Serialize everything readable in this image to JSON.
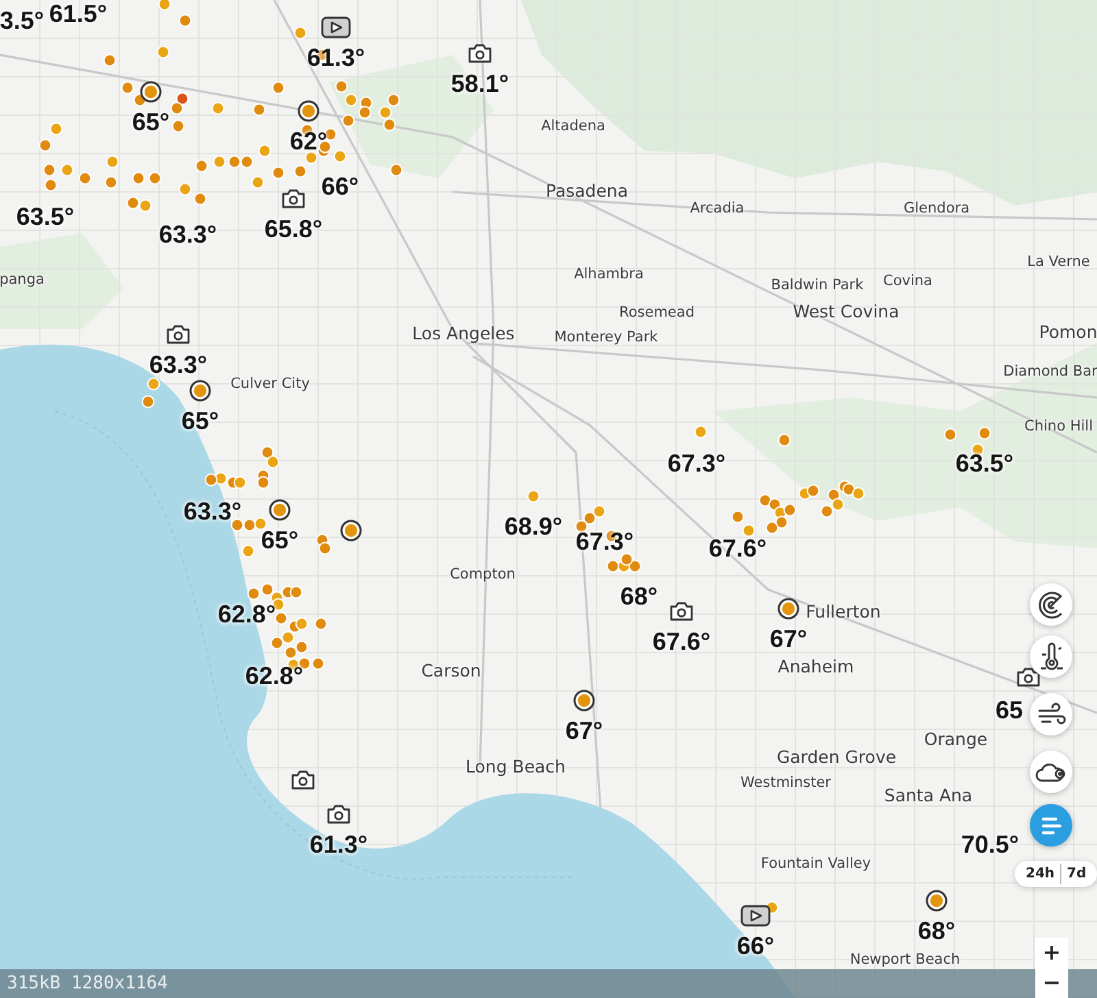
{
  "map": {
    "places": [
      {
        "name": "panga",
        "kind": "town"
      },
      {
        "name": "Altadena",
        "kind": "town"
      },
      {
        "name": "Pasadena",
        "kind": "city"
      },
      {
        "name": "Arcadia",
        "kind": "town"
      },
      {
        "name": "Glendora",
        "kind": "town"
      },
      {
        "name": "La Verne",
        "kind": "town"
      },
      {
        "name": "Alhambra",
        "kind": "town"
      },
      {
        "name": "Baldwin Park",
        "kind": "town"
      },
      {
        "name": "Covina",
        "kind": "town"
      },
      {
        "name": "Rosemead",
        "kind": "town"
      },
      {
        "name": "West Covina",
        "kind": "city"
      },
      {
        "name": "Los Angeles",
        "kind": "city"
      },
      {
        "name": "Monterey Park",
        "kind": "town"
      },
      {
        "name": "Pomon",
        "kind": "city"
      },
      {
        "name": "Diamond Bar",
        "kind": "town"
      },
      {
        "name": "Chino Hill",
        "kind": "town"
      },
      {
        "name": "Culver City",
        "kind": "town"
      },
      {
        "name": "Compton",
        "kind": "town"
      },
      {
        "name": "Fullerton",
        "kind": "city"
      },
      {
        "name": "Carson",
        "kind": "city"
      },
      {
        "name": "Anaheim",
        "kind": "city"
      },
      {
        "name": "Orange",
        "kind": "city"
      },
      {
        "name": "Long Beach",
        "kind": "city"
      },
      {
        "name": "Garden Grove",
        "kind": "city"
      },
      {
        "name": "Westminster",
        "kind": "town"
      },
      {
        "name": "Santa Ana",
        "kind": "city"
      },
      {
        "name": "Fountain Valley",
        "kind": "town"
      },
      {
        "name": "Newport Beach",
        "kind": "town"
      }
    ],
    "readings": [
      {
        "temp": "3.5°",
        "kind": "plain"
      },
      {
        "temp": "61.5°",
        "kind": "plain"
      },
      {
        "temp": "61.3°",
        "kind": "video"
      },
      {
        "temp": "58.1°",
        "kind": "camera"
      },
      {
        "temp": "65°",
        "kind": "station"
      },
      {
        "temp": "62°",
        "kind": "station"
      },
      {
        "temp": "66°",
        "kind": "plain"
      },
      {
        "temp": "63.5°",
        "kind": "plain"
      },
      {
        "temp": "63.3°",
        "kind": "plain"
      },
      {
        "temp": "65.8°",
        "kind": "camera"
      },
      {
        "temp": "63.3°",
        "kind": "camera"
      },
      {
        "temp": "65°",
        "kind": "station"
      },
      {
        "temp": "63.3°",
        "kind": "plain"
      },
      {
        "temp": "65°",
        "kind": "station"
      },
      {
        "temp": "62.8°",
        "kind": "plain"
      },
      {
        "temp": "62.8°",
        "kind": "plain"
      },
      {
        "temp": "61.3°",
        "kind": "camera"
      },
      {
        "temp": "68.9°",
        "kind": "plain"
      },
      {
        "temp": "67.3°",
        "kind": "plain"
      },
      {
        "temp": "67.3°",
        "kind": "plain"
      },
      {
        "temp": "68°",
        "kind": "plain"
      },
      {
        "temp": "67.6°",
        "kind": "camera"
      },
      {
        "temp": "67.6°",
        "kind": "plain"
      },
      {
        "temp": "67°",
        "kind": "station"
      },
      {
        "temp": "63.5°",
        "kind": "plain"
      },
      {
        "temp": "67°",
        "kind": "station"
      },
      {
        "temp": "66°",
        "kind": "video"
      },
      {
        "temp": "68°",
        "kind": "station"
      },
      {
        "temp": "65",
        "kind": "camera"
      },
      {
        "temp": "70.5°",
        "kind": "plain"
      }
    ],
    "extra_markers": [
      {
        "kind": "station"
      },
      {
        "kind": "camera"
      }
    ]
  },
  "controls": {
    "layers": [
      {
        "kind": "radar",
        "selected": false
      },
      {
        "kind": "temperature",
        "selected": false
      },
      {
        "kind": "wind",
        "selected": false
      },
      {
        "kind": "clouds",
        "selected": false
      },
      {
        "kind": "list",
        "selected": true
      }
    ],
    "range": [
      {
        "label": "24h",
        "selected": false
      },
      {
        "label": "7d",
        "selected": false
      }
    ],
    "zoom": [
      {
        "label": "+"
      },
      {
        "label": "−"
      }
    ]
  },
  "image_info": "315kB 1280x1164"
}
